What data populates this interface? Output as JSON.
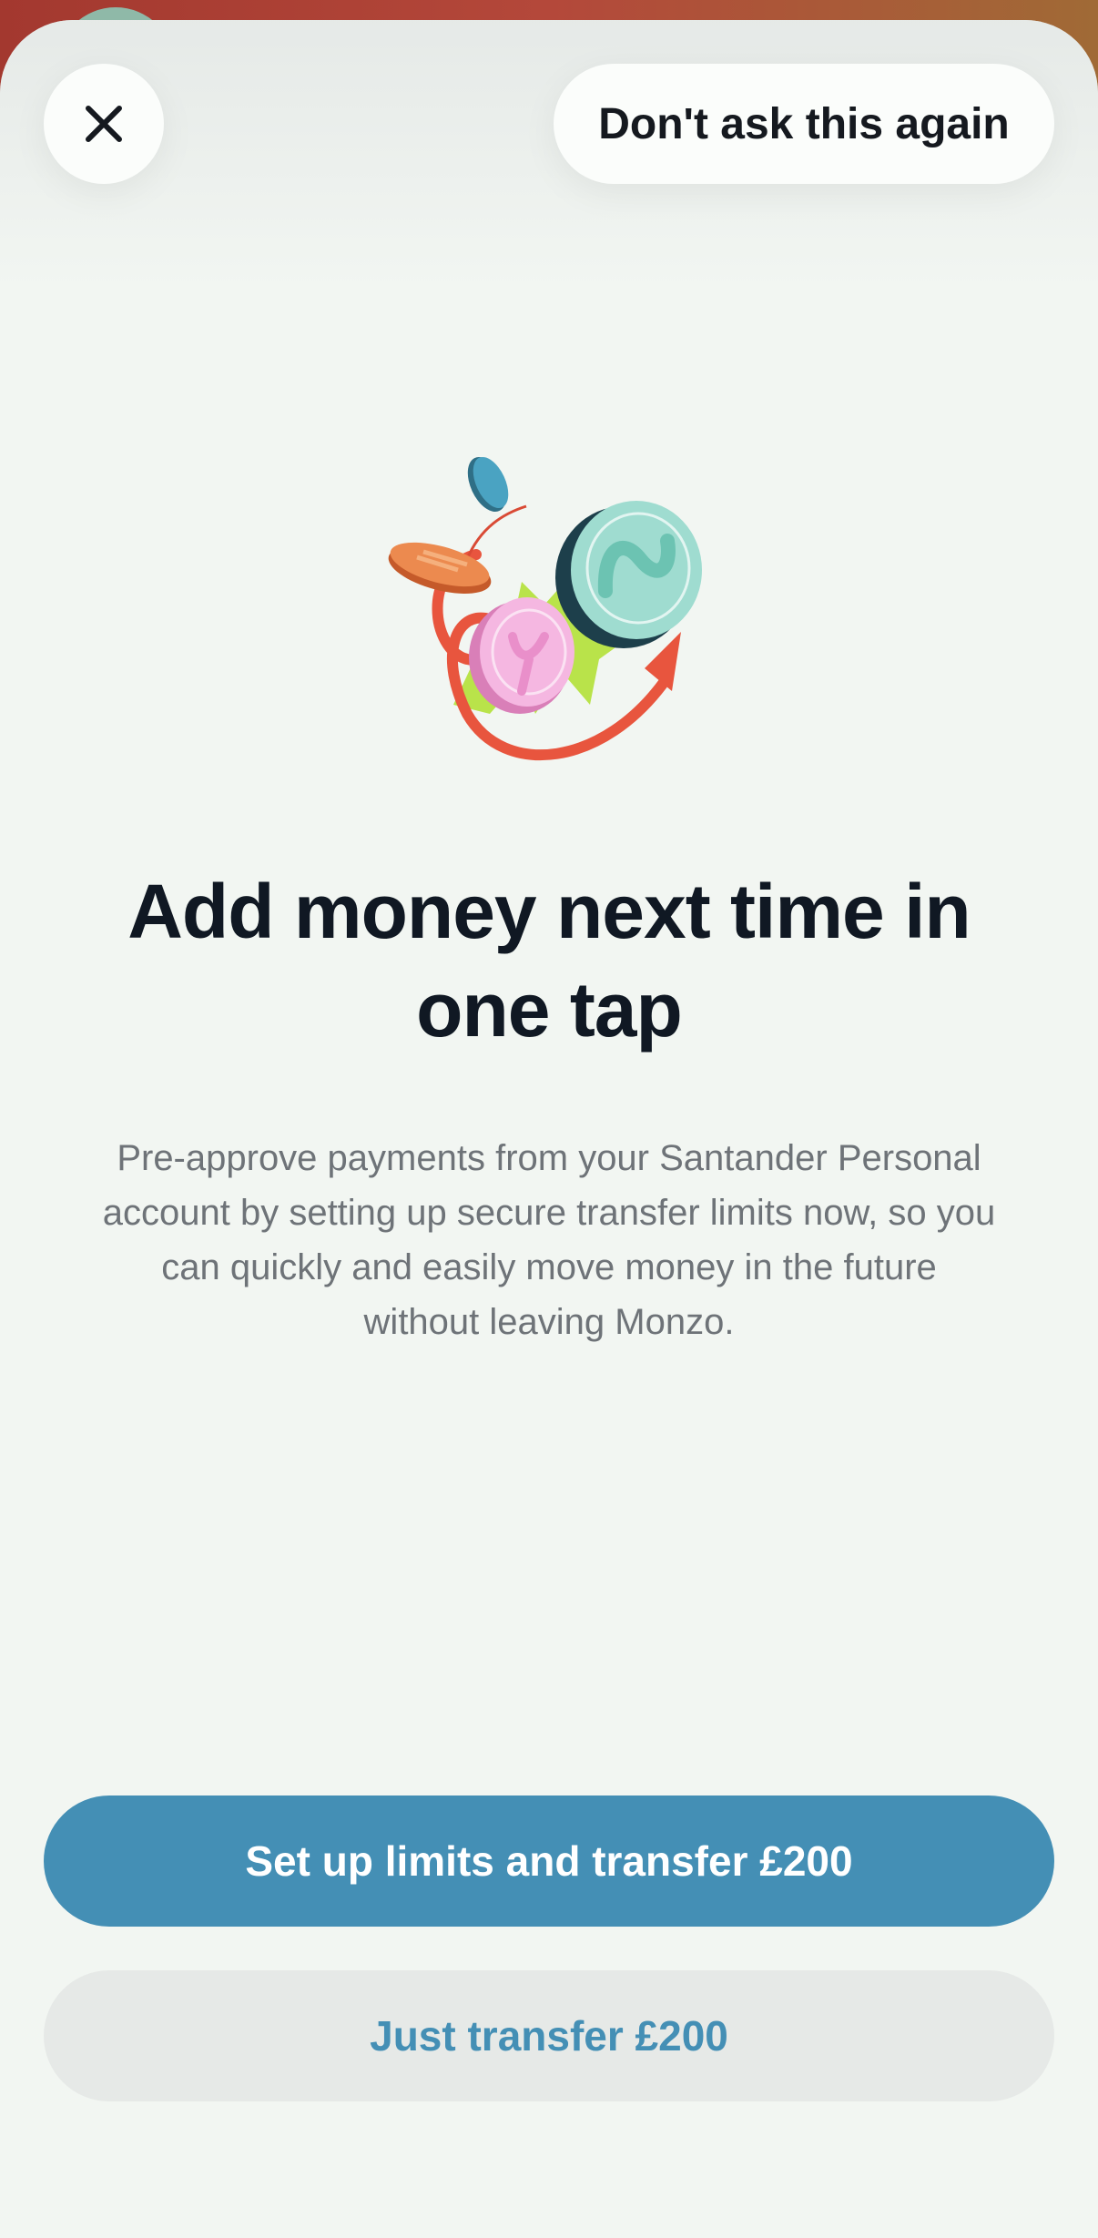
{
  "header": {
    "dont_ask_label": "Don't ask this again"
  },
  "icons": {
    "close": "close-icon",
    "illustration": "coins-arrow-illustration"
  },
  "main": {
    "title": "Add money next time in one tap",
    "description": "Pre-approve payments from your Santander Personal account by setting up secure transfer limits now, so you can quickly and easily move money in the future without leaving Monzo."
  },
  "actions": {
    "primary_label": "Set up limits and transfer £200",
    "secondary_label": "Just transfer £200"
  },
  "colors": {
    "accent": "#448fb5",
    "sheet_background": "#f2f6f2",
    "title": "#101823",
    "body_text": "#6e7378",
    "secondary_button": "#e6e9e7"
  }
}
